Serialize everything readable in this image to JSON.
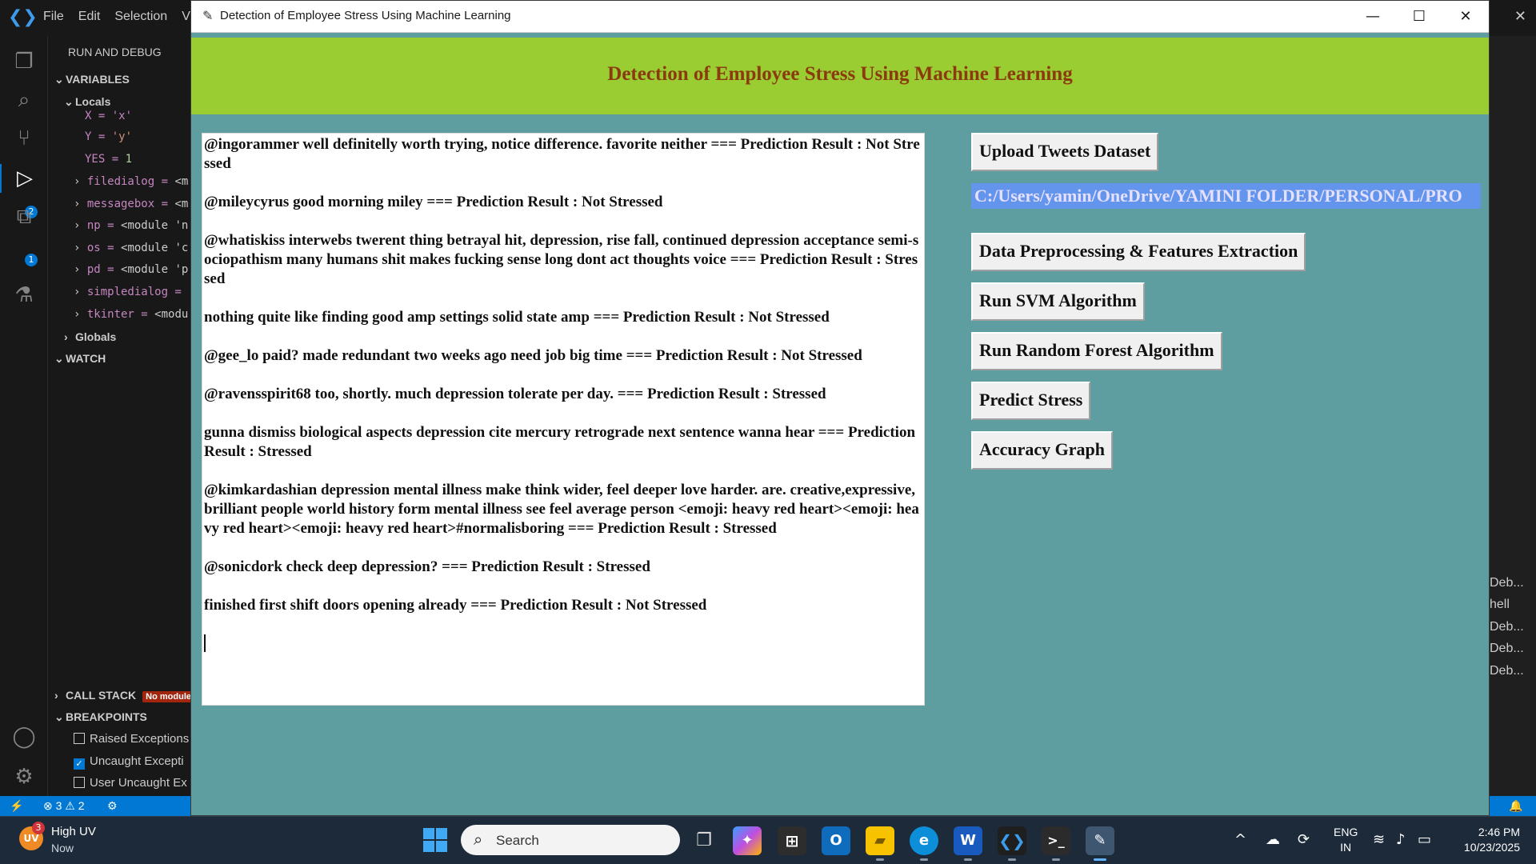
{
  "vscode": {
    "menu": [
      "File",
      "Edit",
      "Selection",
      "V"
    ],
    "side_title": "RUN AND DEBUG",
    "sections": {
      "variables": "VARIABLES",
      "locals": "Locals",
      "globals": "Globals",
      "watch": "WATCH",
      "call_stack": "CALL STACK",
      "call_stack_badge": "No module",
      "breakpoints": "BREAKPOINTS"
    },
    "variables": [
      {
        "key": "X = 'x'",
        "value": ""
      },
      {
        "key": "Y = ",
        "value": "'y'"
      },
      {
        "key": "YES = ",
        "value": "1"
      },
      {
        "key": "filedialog = ",
        "value": "<m"
      },
      {
        "key": "messagebox = ",
        "value": "<m"
      },
      {
        "key": "np = ",
        "value": "<module 'n"
      },
      {
        "key": "os = ",
        "value": "<module 'c"
      },
      {
        "key": "pd = ",
        "value": "<module 'p"
      },
      {
        "key": "simpledialog = ",
        "value": ""
      },
      {
        "key": "tkinter = ",
        "value": "<modu"
      }
    ],
    "breakpoints": [
      "Raised Exceptions",
      "Uncaught Excepti",
      "User Uncaught Ex"
    ],
    "run_debug_badge": "2",
    "extensions_badge": "1",
    "right_terminal_items": [
      "Deb...",
      "hell",
      "Deb...",
      "Deb...",
      "Deb..."
    ],
    "status": {
      "errors": "3",
      "warnings": "2"
    }
  },
  "app": {
    "window_title": "Detection of Employee Stress Using Machine Learning",
    "heading": "Detection of Employee Stress Using Machine Learning",
    "output_lines": [
      "@ingorammer well definitelly worth trying, notice difference. favorite neither === Prediction Result : Not Stressed",
      "@mileycyrus good morning miley === Prediction Result : Not Stressed",
      "@whatiskiss interwebs twerent thing betrayal hit, depression, rise fall, continued depression acceptance semi-sociopathism many humans shit makes fucking sense long dont act thoughts voice === Prediction Result : Stressed",
      "nothing quite like finding good amp settings solid state amp === Prediction Result : Not Stressed",
      "@gee_lo paid? made redundant two weeks ago need job big time === Prediction Result : Not Stressed",
      "@ravensspirit68 too, shortly. much depression tolerate per day. === Prediction Result : Stressed",
      "gunna dismiss biological aspects depression cite mercury retrograde next sentence wanna hear === Prediction Result : Stressed",
      "@kimkardashian depression mental illness make think wider, feel deeper love harder. are. creative,expressive,brilliant people world history form mental illness see feel average person <emoji: heavy red heart><emoji: heavy red heart><emoji: heavy red heart>#normalisboring === Prediction Result : Stressed",
      "@sonicdork check deep depression? === Prediction Result : Stressed",
      "finished first shift doors opening already === Prediction Result : Not Stressed"
    ],
    "buttons": {
      "upload": "Upload Tweets Dataset",
      "preprocess": "Data Preprocessing & Features Extraction",
      "svm": "Run SVM Algorithm",
      "rf": "Run Random Forest Algorithm",
      "predict": "Predict Stress",
      "graph": "Accuracy Graph"
    },
    "path_label": "C:/Users/yamin/OneDrive/YAMINI FOLDER/PERSONAL/PRO",
    "colors": {
      "header_bg": "#9acd32",
      "body_bg": "#5f9ea0",
      "heading": "#8b3a0e",
      "path_bg": "#6495ed"
    }
  },
  "taskbar": {
    "weather_title": "High UV",
    "weather_sub": "Now",
    "weather_badge": "3",
    "weather_icon_label": "UV",
    "search_placeholder": "Search",
    "lang_line1": "ENG",
    "lang_line2": "IN",
    "time": "2:46 PM",
    "date": "10/23/2025",
    "app_letters": {
      "outlook": "O",
      "word": "W",
      "store": "⊞"
    }
  }
}
